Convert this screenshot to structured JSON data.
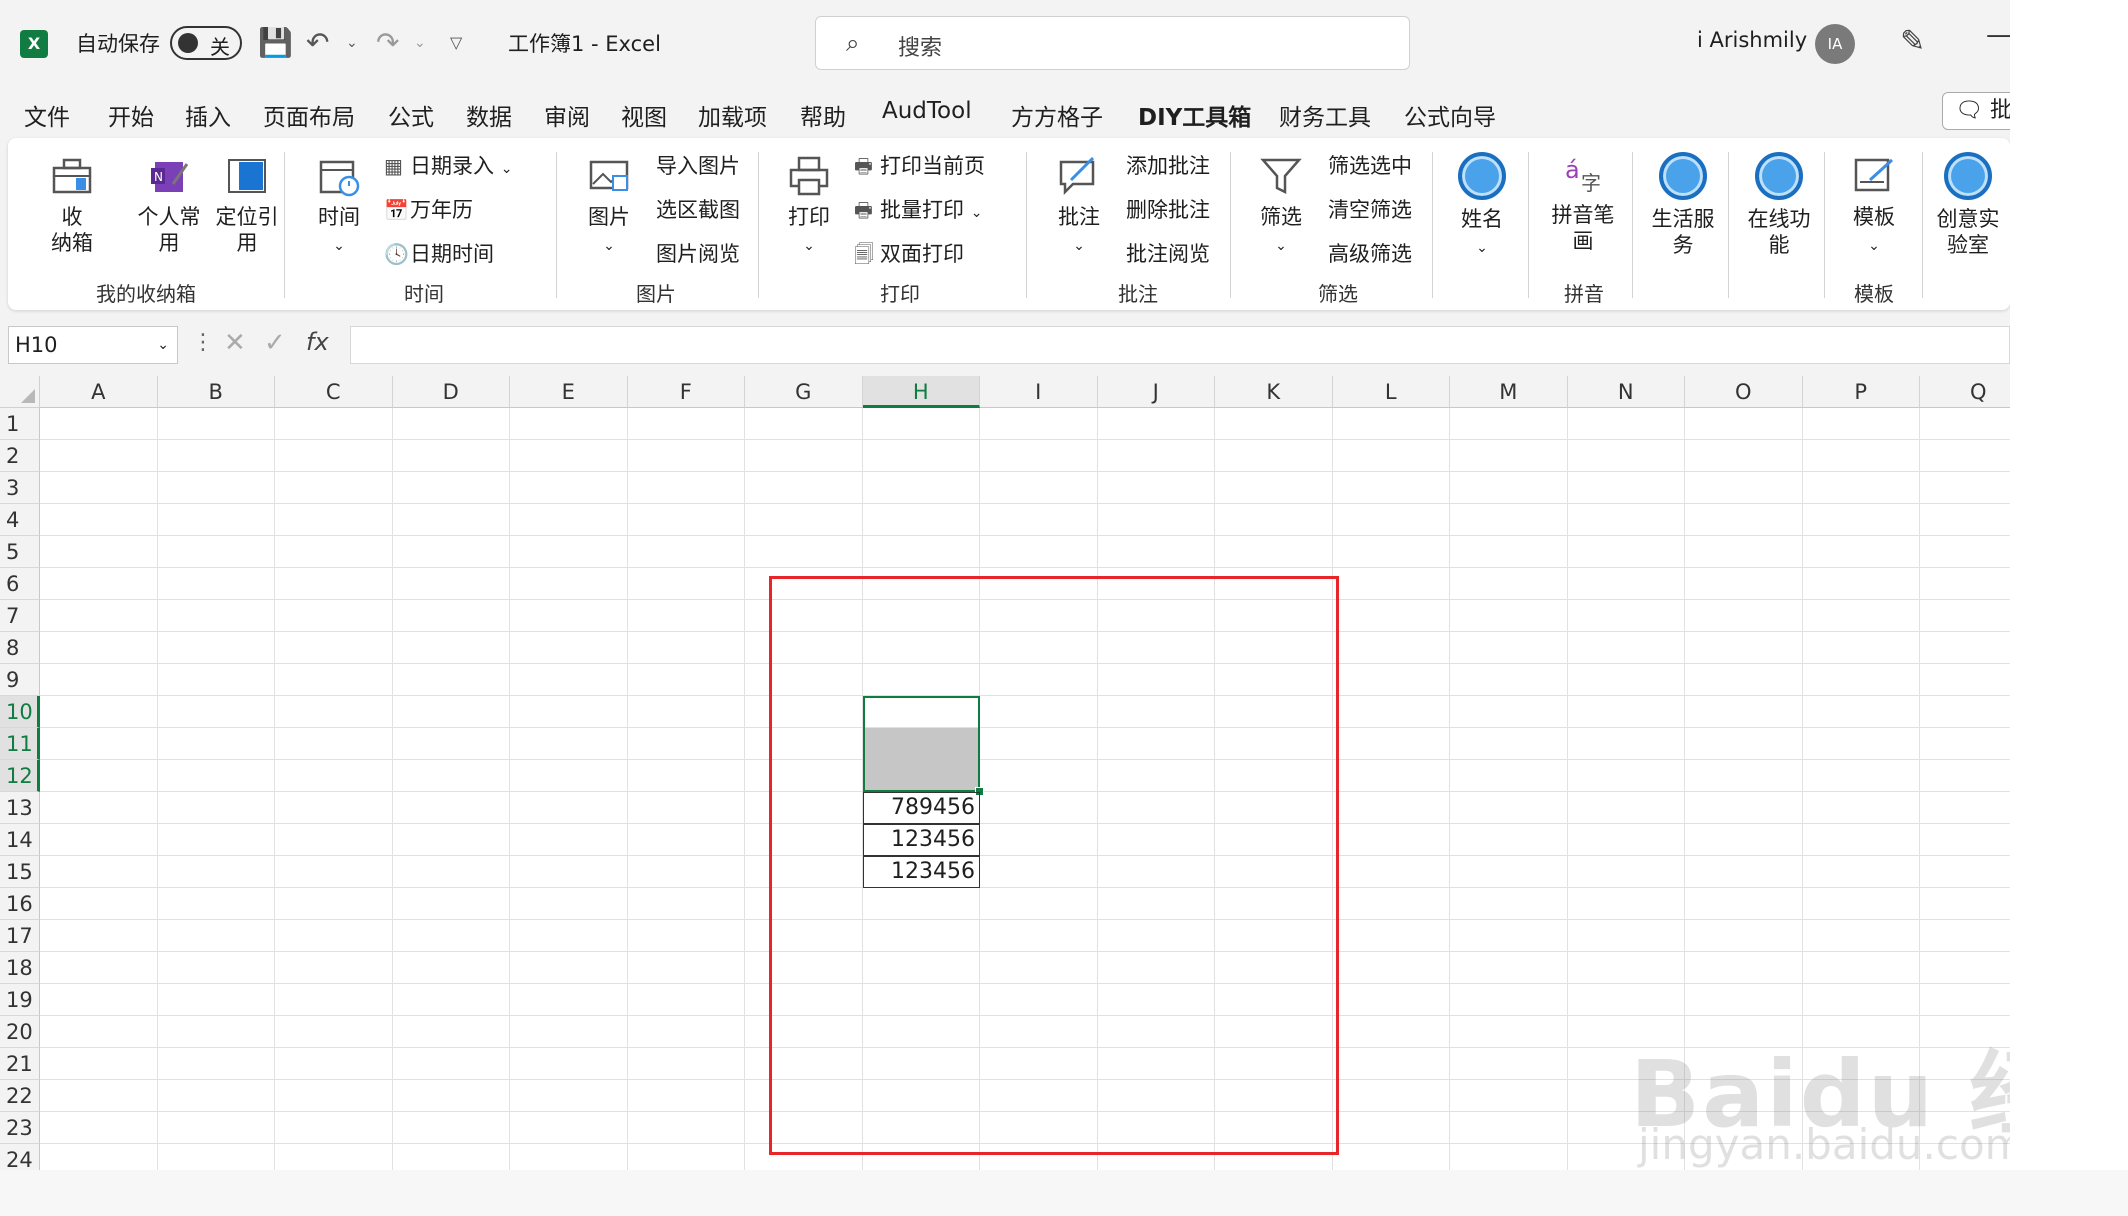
{
  "titlebar": {
    "autosave_label": "自动保存",
    "autosave_state": "关",
    "doc_title": "工作簿1  -  Excel",
    "search_placeholder": "搜索",
    "user_name": "i Arishmily",
    "avatar_initials": "IA",
    "app_logo": "X"
  },
  "ribbon_tabs": [
    "文件",
    "开始",
    "插入",
    "页面布局",
    "公式",
    "数据",
    "审阅",
    "视图",
    "加载项",
    "帮助",
    "AudTool",
    "方方格子",
    "DIY工具箱",
    "财务工具",
    "公式向导"
  ],
  "active_tab": "DIY工具箱",
  "comment_button": "批注",
  "ribbon": {
    "groups": {
      "storage": "我的收纳箱",
      "time": "时间",
      "picture": "图片",
      "print": "打印",
      "comment": "批注",
      "filter": "筛选",
      "pinyin": "拼音",
      "template": "模板"
    },
    "buttons": {
      "shoujin": "收\n纳箱",
      "personal": "个人常\n用",
      "locate": "定位引\n用",
      "time": "时间",
      "date_entry": "日期录入",
      "calendar": "万年历",
      "datetime": "日期时间",
      "picture": "图片",
      "import_pic": "导入图片",
      "area_capture": "选区截图",
      "pic_browse": "图片阅览",
      "print": "打印",
      "print_current": "打印当前页",
      "batch_print": "批量打印",
      "duplex_print": "双面打印",
      "comment": "批注",
      "add_comment": "添加批注",
      "delete_comment": "删除批注",
      "comment_browse": "批注阅览",
      "filter": "筛选",
      "filter_selected": "筛选选中",
      "clear_filter": "清空筛选",
      "advanced_filter": "高级筛选",
      "name": "姓名",
      "pinyin_strokes": "拼音笔\n画",
      "life_service": "生活服\n务",
      "online_func": "在线功\n能",
      "template": "模板",
      "creative_lab": "创意实\n验室"
    }
  },
  "formula_bar": {
    "name_box": "H10",
    "fx": "fx",
    "formula": ""
  },
  "grid": {
    "columns": [
      "A",
      "B",
      "C",
      "D",
      "E",
      "F",
      "G",
      "H",
      "I",
      "J",
      "K",
      "L",
      "M",
      "N",
      "O",
      "P",
      "Q"
    ],
    "rows": [
      "1",
      "2",
      "3",
      "4",
      "5",
      "6",
      "7",
      "8",
      "9",
      "10",
      "11",
      "12",
      "13",
      "14",
      "15",
      "16",
      "17",
      "18",
      "19",
      "20",
      "21",
      "22",
      "23",
      "24"
    ],
    "selected_column": "H",
    "selected_rows": [
      "10",
      "11",
      "12"
    ],
    "active_cell": "H10",
    "cells": [
      {
        "ref": "H13",
        "value": "789456"
      },
      {
        "ref": "H14",
        "value": "123456"
      },
      {
        "ref": "H15",
        "value": "123456"
      }
    ]
  },
  "watermark": {
    "logo": "Baidu 经验",
    "url": "jingyan.baidu.com"
  },
  "colors": {
    "excel_green": "#107c41",
    "annotation_red": "#e8262a",
    "selection_gray": "#c6c6c6"
  }
}
